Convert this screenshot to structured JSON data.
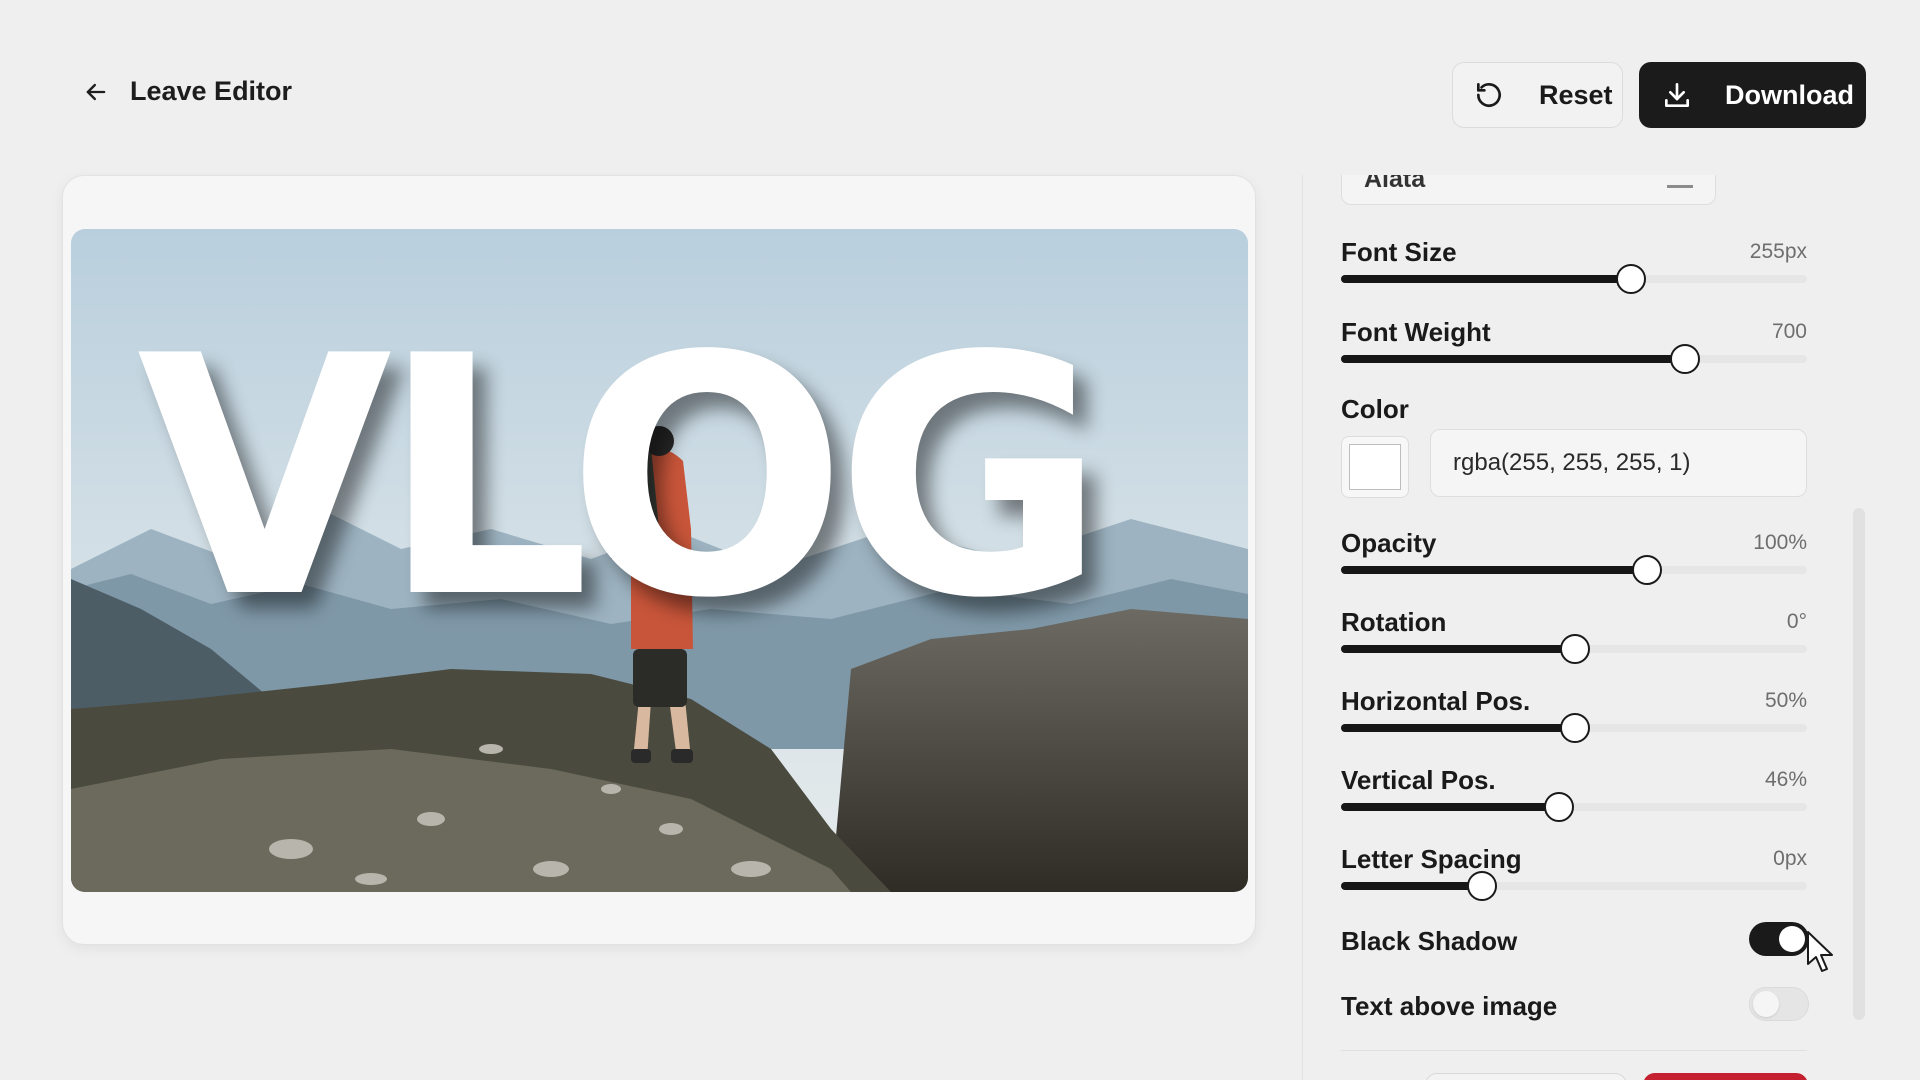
{
  "header": {
    "leave_label": "Leave Editor",
    "reset_label": "Reset",
    "download_label": "Download"
  },
  "preview": {
    "overlay_text": "VLOG"
  },
  "panel": {
    "font_family_value": "Alata",
    "sliders": [
      {
        "label": "Font Size",
        "value": "255px",
        "fraction": 0.62
      },
      {
        "label": "Font Weight",
        "value": "700",
        "fraction": 0.735
      },
      {
        "label": "Opacity",
        "value": "100%",
        "fraction": 0.655
      },
      {
        "label": "Rotation",
        "value": "0°",
        "fraction": 0.5
      },
      {
        "label": "Horizontal Pos.",
        "value": "50%",
        "fraction": 0.5
      },
      {
        "label": "Vertical Pos.",
        "value": "46%",
        "fraction": 0.465
      },
      {
        "label": "Letter Spacing",
        "value": "0px",
        "fraction": 0.3
      }
    ],
    "color": {
      "label": "Color",
      "value": "rgba(255, 255, 255, 1)"
    },
    "toggles": [
      {
        "label": "Black Shadow",
        "on": true
      },
      {
        "label": "Text above image",
        "on": false
      }
    ]
  },
  "colors": {
    "accent": "#1b1b1b",
    "danger": "#c4202f",
    "background": "#efefef"
  },
  "icons": [
    "arrow-left-icon",
    "reset-icon",
    "download-icon",
    "chevron-down-icon"
  ]
}
